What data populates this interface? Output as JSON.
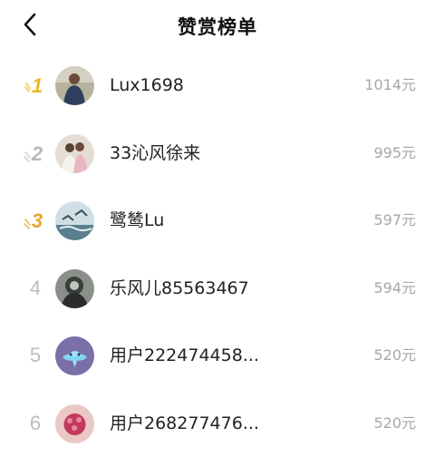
{
  "header": {
    "title": "赞赏榜单"
  },
  "ranks": [
    "1",
    "2",
    "3",
    "4",
    "5",
    "6"
  ],
  "colors": {
    "gold": "#e6b823",
    "silver": "#b8b8b8",
    "bronze": "#e8a62a"
  },
  "rows": [
    {
      "name": "Lux1698",
      "amount": "1014元"
    },
    {
      "name": "33沁风徐来",
      "amount": "995元"
    },
    {
      "name": "鹭鸶Lu",
      "amount": "597元"
    },
    {
      "name": "乐风儿85563467",
      "amount": "594元"
    },
    {
      "name": "用户222474458...",
      "amount": "520元"
    },
    {
      "name": "用户268277476...",
      "amount": "520元"
    }
  ]
}
